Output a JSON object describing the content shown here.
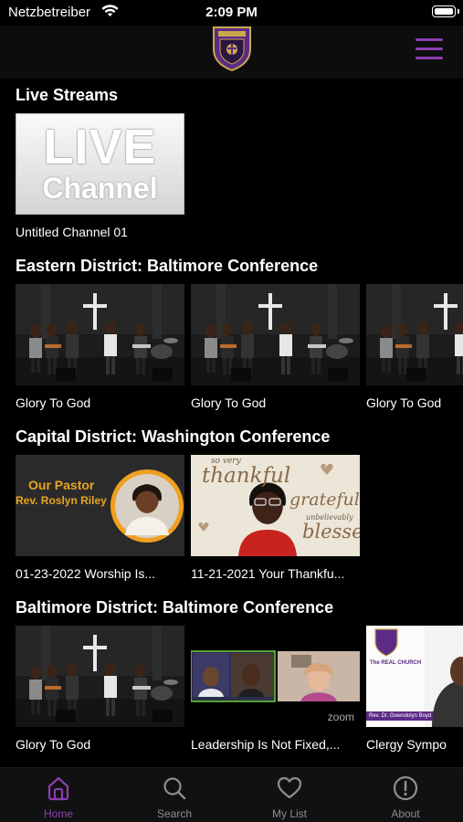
{
  "status_bar": {
    "carrier": "Netzbetreiber",
    "time": "2:09 PM"
  },
  "colors": {
    "accent": "#8a3fb0",
    "background": "#000000",
    "tab_inactive": "#8e8e93"
  },
  "sections": [
    {
      "title": "Live Streams",
      "cards": [
        {
          "caption": "Untitled Channel 01",
          "thumb": {
            "line1": "LIVE",
            "line2": "Channel"
          }
        }
      ]
    },
    {
      "title": "Eastern District: Baltimore Conference",
      "cards": [
        {
          "caption": "Glory To God"
        },
        {
          "caption": "Glory To God"
        },
        {
          "caption": "Glory To God"
        }
      ]
    },
    {
      "title": "Capital District: Washington Conference",
      "cards": [
        {
          "caption": "01-23-2022 Worship Is...",
          "thumb": {
            "line1": "Our Pastor",
            "line2": "Rev. Roslyn Riley"
          }
        },
        {
          "caption": "11-21-2021 Your Thankfu...",
          "thumb": {
            "line1": "so very",
            "line2": "thankful",
            "line3": "grateful",
            "line4": "unbelievably",
            "line5": "blessed"
          }
        }
      ]
    },
    {
      "title": "Baltimore District: Baltimore Conference",
      "cards": [
        {
          "caption": "Glory To God"
        },
        {
          "caption": "Leadership Is Not Fixed,...",
          "thumb": {
            "watermark": "zoom"
          }
        },
        {
          "caption": "Clergy Sympo",
          "thumb": {
            "line1": "The REAL CHURCH",
            "line2": "Rev. Dr. Gwendolyn Boyd"
          }
        }
      ]
    }
  ],
  "tabs": [
    {
      "label": "Home",
      "icon": "home-icon",
      "active": true
    },
    {
      "label": "Search",
      "icon": "search-icon",
      "active": false
    },
    {
      "label": "My List",
      "icon": "heart-icon",
      "active": false
    },
    {
      "label": "About",
      "icon": "info-icon",
      "active": false
    }
  ]
}
